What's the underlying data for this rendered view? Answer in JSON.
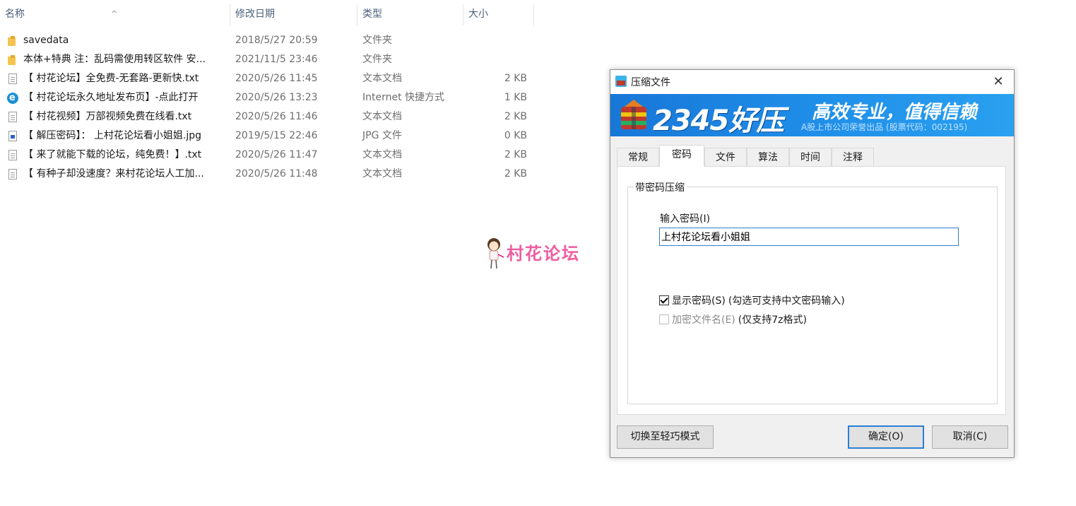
{
  "explorer": {
    "columns": {
      "name": "名称",
      "date": "修改日期",
      "type": "类型",
      "size": "大小"
    },
    "files": [
      {
        "icon": "folder-icon",
        "name": "savedata",
        "date": "2018/5/27 20:59",
        "type": "文件夹",
        "size": ""
      },
      {
        "icon": "folder-icon",
        "name": "本体+特典 注：乱码需使用转区软件 安...",
        "date": "2021/11/5 23:46",
        "type": "文件夹",
        "size": ""
      },
      {
        "icon": "text-file-icon",
        "name": "【 村花论坛】全免费-无套路-更新快.txt",
        "date": "2020/5/26 11:45",
        "type": "文本文档",
        "size": "2 KB"
      },
      {
        "icon": "internet-shortcut-icon",
        "name": "【 村花论坛永久地址发布页】-点此打开",
        "date": "2020/5/26 13:23",
        "type": "Internet 快捷方式",
        "size": "1 KB"
      },
      {
        "icon": "text-file-icon",
        "name": "【 村花视频】万部视频免费在线看.txt",
        "date": "2020/5/26 11:46",
        "type": "文本文档",
        "size": "2 KB"
      },
      {
        "icon": "image-file-icon",
        "name": "【 解压密码】： 上村花论坛看小姐姐.jpg",
        "date": "2019/5/15 22:46",
        "type": "JPG 文件",
        "size": "0 KB"
      },
      {
        "icon": "text-file-icon",
        "name": "【 来了就能下载的论坛，纯免费！】.txt",
        "date": "2020/5/26 11:47",
        "type": "文本文档",
        "size": "2 KB"
      },
      {
        "icon": "text-file-icon",
        "name": "【 有种子却没速度？来村花论坛人工加...",
        "date": "2020/5/26 11:48",
        "type": "文本文档",
        "size": "2 KB"
      }
    ]
  },
  "watermark": {
    "text": "村花论坛"
  },
  "dialog": {
    "title": "压缩文件",
    "banner": {
      "logo": "2345好压",
      "slogan": "高效专业，值得信赖",
      "subtext": "A股上市公司荣誉出品 (股票代码：002195)"
    },
    "tabs": [
      "常规",
      "密码",
      "文件",
      "算法",
      "时间",
      "注释"
    ],
    "active_tab": "密码",
    "group_title": "带密码压缩",
    "password_label": "输入密码(I)",
    "password_value": "上村花论坛看小姐姐",
    "show_password": {
      "label": "显示密码(S)",
      "note": "(勾选可支持中文密码输入)",
      "checked": true
    },
    "encrypt_names": {
      "label": "加密文件名(E)",
      "note": "(仅支持7z格式)",
      "checked": false,
      "enabled": false
    },
    "buttons": {
      "switch_mode": "切换至轻巧模式",
      "ok": "确定(O)",
      "cancel": "取消(C)"
    },
    "colors": {
      "banner": "#1f8ee8",
      "focus_border": "#2a7fd4"
    }
  }
}
